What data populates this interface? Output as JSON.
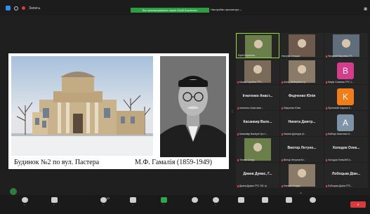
{
  "topbar": {
    "title": "Запись",
    "banner": "Вы просматриваете экран Юрій Корнієнко",
    "view_options": "Настройки просмотра",
    "view_button": "Вид"
  },
  "slide": {
    "caption_building": "Будинок №2 по вул. Пастера",
    "caption_portrait": "М.Ф. Гамалія (1859-1949)"
  },
  "gallery": {
    "tiles": [
      {
        "label": "Юрій Корнієнко",
        "big": "",
        "avatar": "",
        "color": ""
      },
      {
        "label": "Наталія Отоцька",
        "big": "",
        "avatar": "",
        "color": ""
      },
      {
        "label": "Патрахій Вероніка ГР...",
        "big": "",
        "avatar": "",
        "color": ""
      },
      {
        "label": "Маша Сорткіна ГРС...",
        "big": "",
        "avatar": "",
        "color": ""
      },
      {
        "label": "Анна_Шевчукнка гр...",
        "big": "",
        "avatar": "",
        "color": ""
      },
      {
        "label": "Марія Салаєва ГРС 1...",
        "big": "",
        "avatar": "B",
        "color": "#d43c8c"
      },
      {
        "label": "Ігнатенко Анастасія...",
        "big": "Ігнатенко Анаст...",
        "avatar": "",
        "color": ""
      },
      {
        "label": "Федченко Юлія",
        "big": "Федченко Юлія",
        "avatar": "",
        "color": ""
      },
      {
        "label": "Пустовойт Карина К...",
        "big": "",
        "avatar": "K",
        "color": "#ef7d1a"
      },
      {
        "label": "Касанківр Валерія Грс 1...",
        "big": "Касанкир Вале...",
        "avatar": "",
        "color": ""
      },
      {
        "label": "Никита Дмитрук (4...",
        "big": "Никита Дмитр...",
        "avatar": "",
        "color": ""
      },
      {
        "label": "Бабічук Анастасія К...",
        "big": "",
        "avatar": "A",
        "color": "#7f93a6"
      },
      {
        "label": "Тетяна Скітур",
        "big": "",
        "avatar": "",
        "color": ""
      },
      {
        "label": "Віктор Летунов Кіт...",
        "big": "Виктор Летуно...",
        "avatar": "",
        "color": ""
      },
      {
        "label": "Холодок Олексій Бл...",
        "big": "Холодок Олек...",
        "avatar": "",
        "color": ""
      },
      {
        "label": "Диана Думас ГРС 101 гр",
        "big": "Диана Думас, Г...",
        "avatar": "",
        "color": ""
      },
      {
        "label": "Наталя Осадчо",
        "big": "",
        "avatar": "",
        "color": ""
      },
      {
        "label": "Лобоцька Діана ГРС...",
        "big": "Лобоцька Діан...",
        "avatar": "",
        "color": ""
      }
    ]
  },
  "toolbar": {
    "participants_count": "22"
  },
  "colors": {
    "active_speaker": "#9bdc2f",
    "banner_green": "#2e9e43",
    "mic_muted": "#e23b3b",
    "leave": "#d93a3a"
  }
}
